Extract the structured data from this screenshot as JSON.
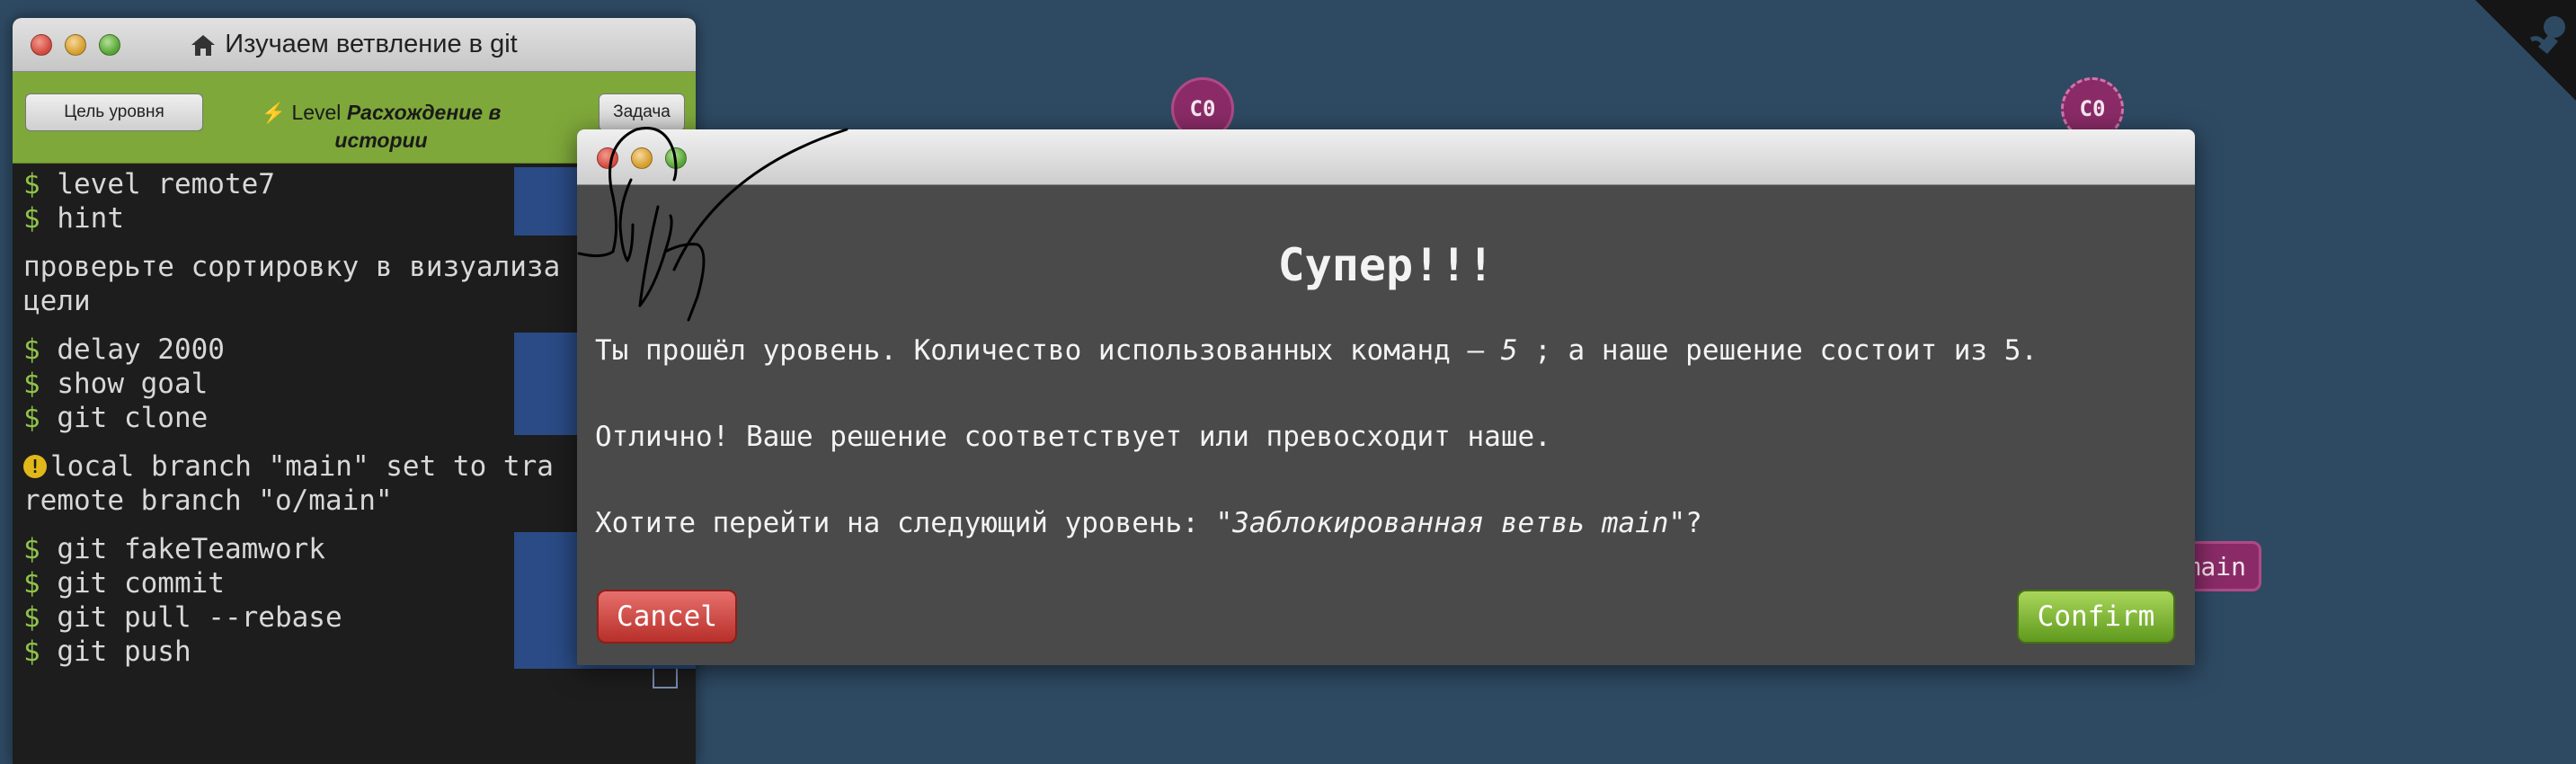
{
  "colors": {
    "background": "#2e4a63",
    "terminal_bg": "#1d1d1d",
    "level_bar": "#7ea83a",
    "prompt": "#8fc24a",
    "node": "#8a2b67",
    "modal_bg": "#4a4a4a",
    "cancel": "#c9413c",
    "confirm": "#7fb734"
  },
  "icons": {
    "home": "home-icon",
    "bolt": "bolt-icon",
    "warning": "warning-icon",
    "corner": "octocat-corner-icon"
  },
  "visualization": {
    "nodes": [
      "C0",
      "C0"
    ],
    "branch_label": "main"
  },
  "terminal": {
    "title": "Изучаем ветвление в git",
    "goal_button": "Цель уровня",
    "task_button": "Задача",
    "level_prefix": "Level",
    "level_name": "Расхождение в истории",
    "blocks": [
      {
        "commands": [
          "level remote7",
          "hint"
        ]
      },
      {
        "message": "проверьте сортировку в визуализа\nцели"
      },
      {
        "commands": [
          "delay 2000",
          "show goal",
          "git clone"
        ]
      },
      {
        "warning": "local branch \"main\" set to tra\nremote branch \"o/main\""
      },
      {
        "commands": [
          "git fakeTeamwork",
          "git commit",
          "git pull --rebase",
          "git push"
        ]
      }
    ]
  },
  "modal": {
    "heading": "Супер!!!",
    "line1_prefix": "Ты прошёл уровень. Количество использованных команд – ",
    "line1_count": "5",
    "line1_suffix": " ; а наше решение состоит из 5.",
    "line2": "Отлично! Ваше решение соответствует или превосходит наше.",
    "line3_prefix": "Хотите перейти на следующий уровень: \"",
    "line3_level": "Заблокированная ветвь main",
    "line3_suffix": "\"?",
    "cancel_label": "Cancel",
    "confirm_label": "Confirm"
  }
}
